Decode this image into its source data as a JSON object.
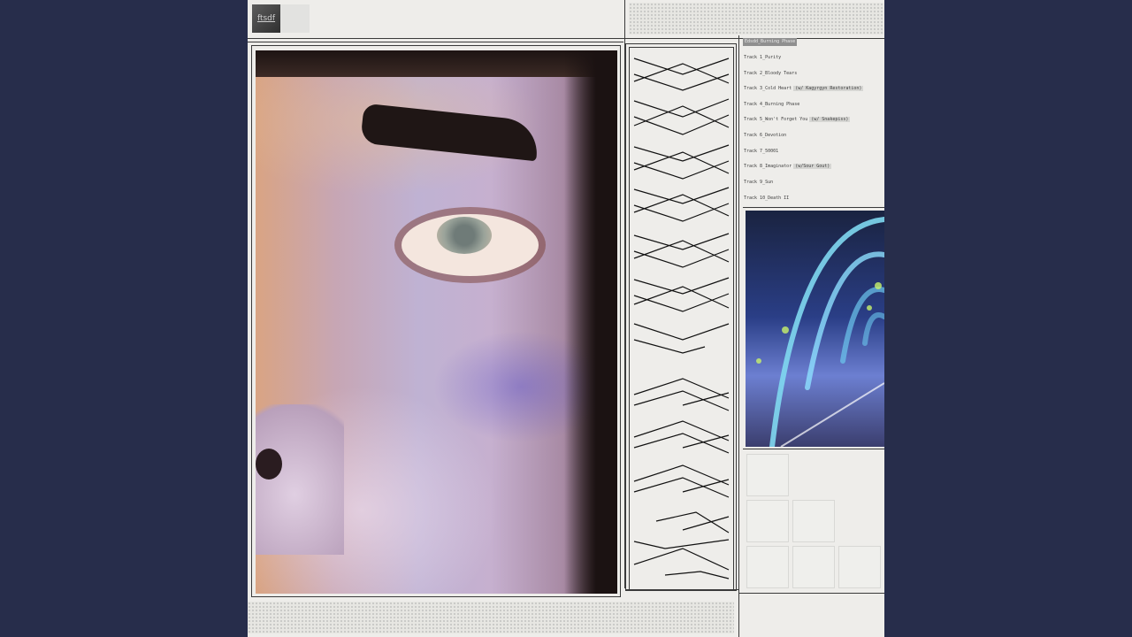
{
  "logo": {
    "text": "ftsdf"
  },
  "album": {
    "title": "Edsdd_Burning Phase"
  },
  "tracks": [
    {
      "label": "Track 1_Purity",
      "feature": ""
    },
    {
      "label": "Track 2_Bloody Tears",
      "feature": ""
    },
    {
      "label": "Track 3_Cold Heart",
      "feature": "(w/ Kagyrgyn Restoration)"
    },
    {
      "label": "Track 4_Burning Phase",
      "feature": ""
    },
    {
      "label": "Track 5_Won't Forget You",
      "feature": "(w/ Snakepiss)"
    },
    {
      "label": "Track 6_Devotion",
      "feature": ""
    },
    {
      "label": "Track 7_50001",
      "feature": ""
    },
    {
      "label": "Track 8_Imaginator",
      "feature": "(w/Sour Gout)"
    },
    {
      "label": "Track 9_Sun",
      "feature": ""
    },
    {
      "label": "Track 10_Death II",
      "feature": ""
    }
  ],
  "colors": {
    "background": "#272d4b",
    "cover": "#eeedea",
    "lines": "#3a3a3a"
  },
  "images": {
    "main": "face-closeup-photo",
    "side": "neon-tunnel-photo"
  }
}
